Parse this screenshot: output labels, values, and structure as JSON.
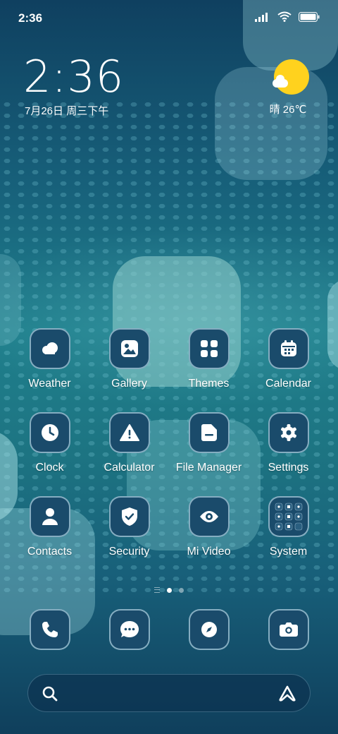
{
  "status_bar": {
    "time": "2:36"
  },
  "lock_widget": {
    "time": "2:36",
    "date": "7月26日 周三下午"
  },
  "weather_widget": {
    "text": "晴 26℃",
    "sun_color": "#ffd21e"
  },
  "apps": [
    {
      "label": "Weather",
      "icon": "weather-icon"
    },
    {
      "label": "Gallery",
      "icon": "gallery-icon"
    },
    {
      "label": "Themes",
      "icon": "themes-icon"
    },
    {
      "label": "Calendar",
      "icon": "calendar-icon"
    },
    {
      "label": "Clock",
      "icon": "clock-icon"
    },
    {
      "label": "Calculator",
      "icon": "calculator-icon"
    },
    {
      "label": "File Manager",
      "icon": "file-manager-icon"
    },
    {
      "label": "Settings",
      "icon": "settings-icon"
    },
    {
      "label": "Contacts",
      "icon": "contacts-icon"
    },
    {
      "label": "Security",
      "icon": "security-icon"
    },
    {
      "label": "Mi Video",
      "icon": "mi-video-icon"
    },
    {
      "label": "System",
      "icon": "system-folder-icon"
    }
  ],
  "pager": {
    "pages": 2,
    "active": 1
  },
  "dock": [
    {
      "icon": "phone-icon"
    },
    {
      "icon": "messages-icon"
    },
    {
      "icon": "browser-icon"
    },
    {
      "icon": "camera-icon"
    }
  ],
  "colors": {
    "icon_bg": "#1a4b6b",
    "accent": "#ffd21e"
  }
}
